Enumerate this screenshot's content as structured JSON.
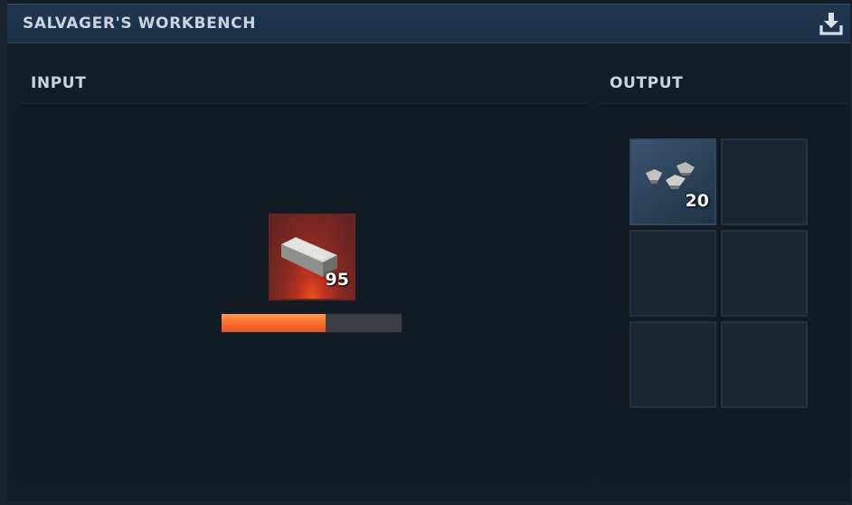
{
  "window": {
    "title": "SALVAGER'S WORKBENCH",
    "action_icon": "download-icon"
  },
  "input_panel": {
    "title": "INPUT",
    "slot": {
      "item_icon": "metal-bar-icon",
      "quantity": "95"
    },
    "progress": 0.58
  },
  "output_panel": {
    "title": "OUTPUT",
    "slots": [
      {
        "item_icon": "metal-scraps-icon",
        "quantity": "20"
      },
      {
        "item_icon": "",
        "quantity": ""
      },
      {
        "item_icon": "",
        "quantity": ""
      },
      {
        "item_icon": "",
        "quantity": ""
      },
      {
        "item_icon": "",
        "quantity": ""
      },
      {
        "item_icon": "",
        "quantity": ""
      }
    ]
  },
  "colors": {
    "titlebar": "#213750",
    "progress_fill": "#ff7a33",
    "input_slot_glow": "#c0331f"
  }
}
